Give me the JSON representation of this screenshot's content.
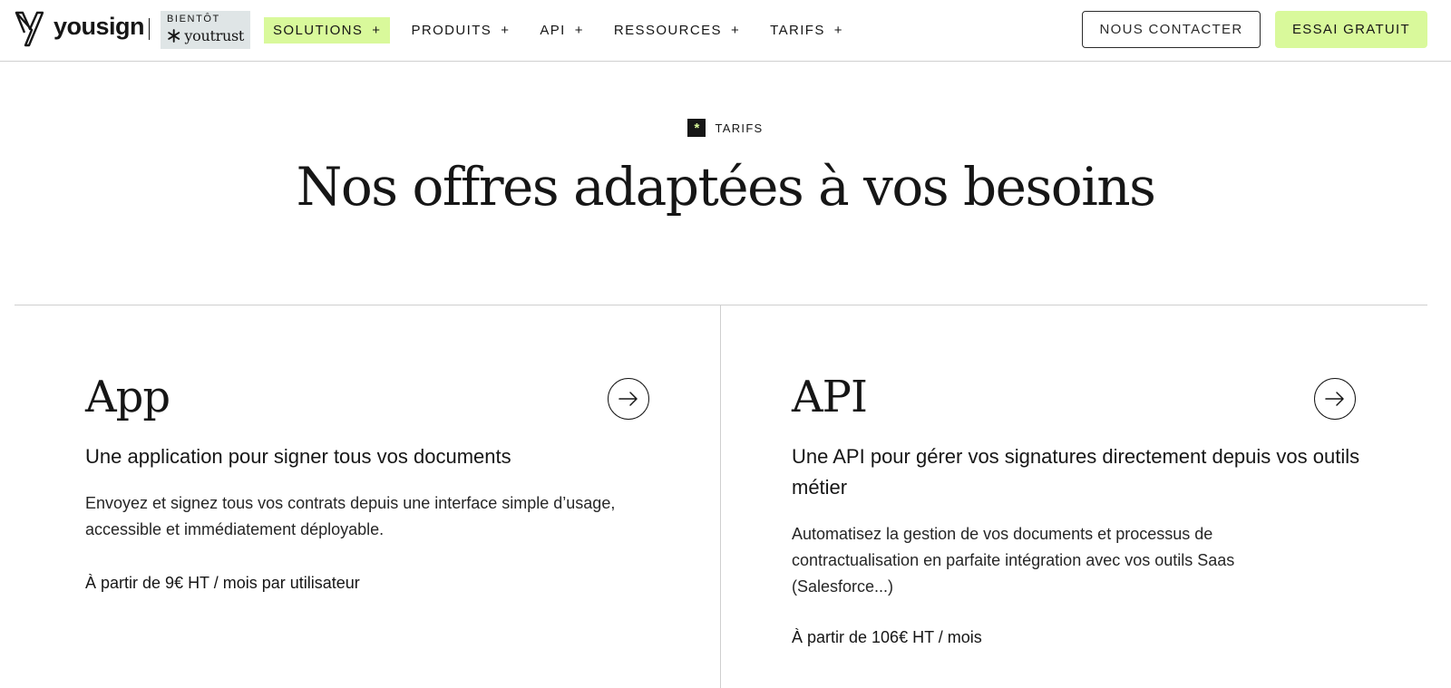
{
  "header": {
    "brand": "yousign",
    "soon_badge": {
      "label": "BIENTÔT",
      "brand": "youtrust"
    },
    "nav": [
      {
        "label": "SOLUTIONS",
        "active": true
      },
      {
        "label": "PRODUITS",
        "active": false
      },
      {
        "label": "API",
        "active": false
      },
      {
        "label": "RESSOURCES",
        "active": false
      },
      {
        "label": "TARIFS",
        "active": false
      }
    ],
    "nav_expand_symbol": "+",
    "contact_label": "NOUS CONTACTER",
    "trial_label": "ESSAI GRATUIT"
  },
  "hero": {
    "eyebrow_symbol": "*",
    "eyebrow": "TARIFS",
    "title": "Nos offres adaptées à vos besoins"
  },
  "offers": [
    {
      "title": "App",
      "subtitle": "Une application pour signer tous vos documents",
      "description": "Envoyez et signez tous vos contrats depuis une interface simple d’usage, accessible et immédiatement déployable.",
      "price": "À partir de 9€ HT / mois par utilisateur",
      "icon": "arrow-right-icon"
    },
    {
      "title": "API",
      "subtitle": "Une API pour gérer vos signatures directement depuis vos outils métier",
      "description": "Automatisez la gestion de vos documents et processus de contractualisation en parfaite intégration avec vos outils Saas (Salesforce...)",
      "price": "À partir de 106€ HT / mois",
      "icon": "arrow-right-icon"
    }
  ],
  "colors": {
    "accent": "#d9f99b",
    "text": "#161616",
    "divider": "#cfcfcf",
    "badge_bg": "#dfe5e6"
  }
}
